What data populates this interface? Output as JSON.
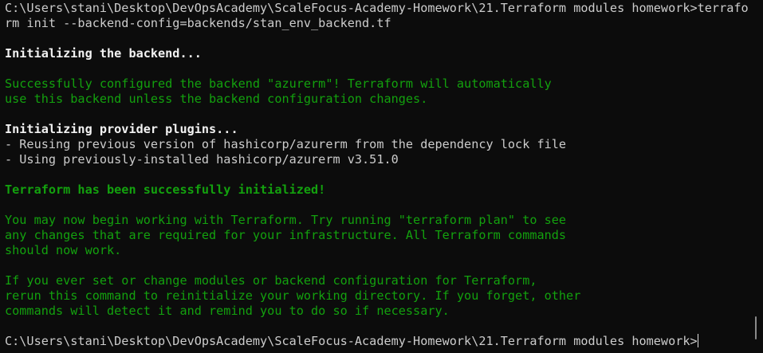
{
  "terminal": {
    "lines": [
      {
        "text": "C:\\Users\\stani\\Desktop\\DevOpsAcademy\\ScaleFocus-Academy-Homework\\21.Terraform modules homework>terrafo",
        "style": "normal"
      },
      {
        "text": "rm init --backend-config=backends/stan_env_backend.tf",
        "style": "normal"
      },
      {
        "text": "",
        "style": "normal"
      },
      {
        "text": "Initializing the backend...",
        "style": "bold"
      },
      {
        "text": "",
        "style": "normal"
      },
      {
        "text": "Successfully configured the backend \"azurerm\"! Terraform will automatically",
        "style": "green"
      },
      {
        "text": "use this backend unless the backend configuration changes.",
        "style": "green"
      },
      {
        "text": "",
        "style": "normal"
      },
      {
        "text": "Initializing provider plugins...",
        "style": "bold"
      },
      {
        "text": "- Reusing previous version of hashicorp/azurerm from the dependency lock file",
        "style": "normal"
      },
      {
        "text": "- Using previously-installed hashicorp/azurerm v3.51.0",
        "style": "normal"
      },
      {
        "text": "",
        "style": "normal"
      },
      {
        "text": "Terraform has been successfully initialized!",
        "style": "green bold-green"
      },
      {
        "text": "",
        "style": "normal"
      },
      {
        "text": "You may now begin working with Terraform. Try running \"terraform plan\" to see",
        "style": "green"
      },
      {
        "text": "any changes that are required for your infrastructure. All Terraform commands",
        "style": "green"
      },
      {
        "text": "should now work.",
        "style": "green"
      },
      {
        "text": "",
        "style": "normal"
      },
      {
        "text": "If you ever set or change modules or backend configuration for Terraform,",
        "style": "green"
      },
      {
        "text": "rerun this command to reinitialize your working directory. If you forget, other",
        "style": "green"
      },
      {
        "text": "commands will detect it and remind you to do so if necessary.",
        "style": "green"
      },
      {
        "text": "",
        "style": "normal"
      }
    ],
    "prompt": "C:\\Users\\stani\\Desktop\\DevOpsAcademy\\ScaleFocus-Academy-Homework\\21.Terraform modules homework>"
  },
  "colors": {
    "background": "#0c0c0c",
    "text": "#cccccc",
    "green": "#13a10e"
  }
}
